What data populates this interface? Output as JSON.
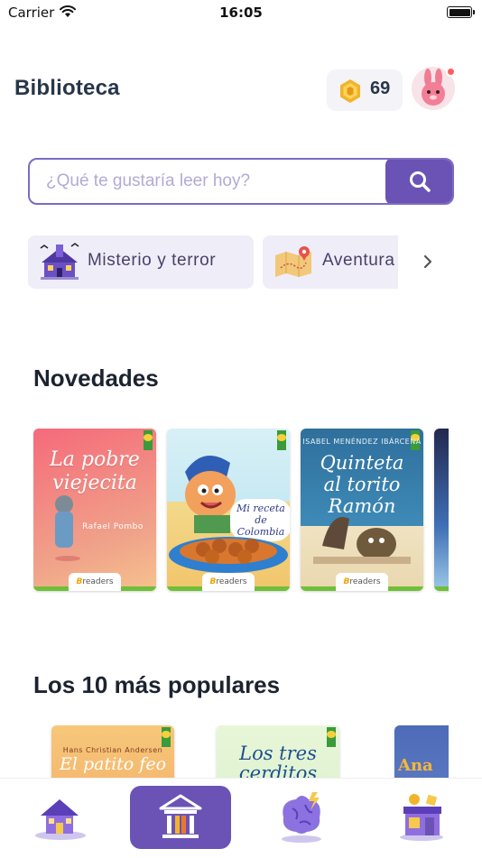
{
  "status_bar": {
    "carrier": "Carrier",
    "time": "16:05"
  },
  "header": {
    "title": "Biblioteca",
    "coins": "69"
  },
  "search": {
    "placeholder": "¿Qué te gustaría leer hoy?"
  },
  "categories": [
    {
      "label": "Misterio y terror",
      "icon": "haunted-house-icon"
    },
    {
      "label": "Aventura",
      "icon": "treasure-map-icon"
    }
  ],
  "sections": {
    "novedades": {
      "title": "Novedades",
      "books": [
        {
          "title": "La pobre viejecita",
          "author": "Rafael Pombo",
          "brand": "readers"
        },
        {
          "title": "Mi receta de Colombia",
          "author": "",
          "brand": "readers"
        },
        {
          "title": "Quinteta al torito Ramón",
          "author": "ISABEL MENÉNDEZ IBÁRCENA",
          "brand": "readers"
        }
      ]
    },
    "populares": {
      "title": "Los 10 más populares",
      "books": [
        {
          "title": "El patito feo",
          "author": "Hans Christian Andersen"
        },
        {
          "title": "Los tres cerditos",
          "author": ""
        },
        {
          "title": "Ana",
          "author": ""
        }
      ]
    }
  },
  "nav": [
    {
      "name": "home",
      "icon": "house-icon"
    },
    {
      "name": "library",
      "icon": "library-icon",
      "active": true
    },
    {
      "name": "brain",
      "icon": "brain-icon"
    },
    {
      "name": "store",
      "icon": "store-icon"
    }
  ],
  "colors": {
    "accent": "#6a53b5",
    "title": "#27364a",
    "chip_bg": "#efedf8"
  }
}
